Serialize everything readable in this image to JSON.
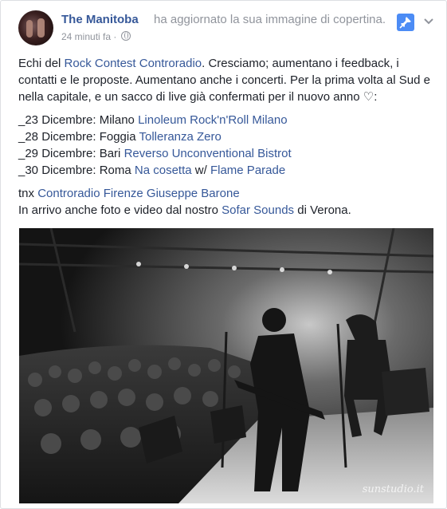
{
  "post": {
    "page_name": "The Manitoba",
    "action_text": "ha aggiornato la sua immagine di copertina.",
    "timestamp": "24 minuti fa",
    "meta_separator": "·",
    "pin_icon": "pin-icon",
    "chevron_icon": "chevron-down-icon",
    "privacy_icon": "globe-icon",
    "accent_color": "#4c8cf5",
    "link_color": "#365899"
  },
  "content": {
    "intro": {
      "t1": "Echi del ",
      "link1": "Rock Contest Controradio",
      "t2": ". Cresciamo; aumentano i feedback, i contatti e le proposte. Aumentano anche i concerti. Per la prima volta al Sud e nella capitale, e un sacco di live già confermati per il nuovo anno ♡:"
    },
    "dates": [
      {
        "prefix": "_23 Dicembre: Milano ",
        "link": "Linoleum Rock'n'Roll Milano"
      },
      {
        "prefix": "_28 Dicembre: Foggia ",
        "link": "Tolleranza Zero"
      },
      {
        "prefix": "_29 Dicembre: Bari ",
        "link": "Reverso Unconventional Bistrot"
      },
      {
        "prefix": "_30 Dicembre: Roma ",
        "link": "Na cosetta",
        "middle": " w/ ",
        "link2": "Flame Parade"
      }
    ],
    "thanks": {
      "prefix": "tnx ",
      "link1": "Controradio Firenze",
      "space": " ",
      "link2": "Giuseppe Barone"
    },
    "closing": {
      "t1": "In arrivo anche foto e video dal nostro ",
      "link": "Sofar Sounds",
      "t2": " di Verona."
    }
  },
  "photo": {
    "watermark": "sunstudio.it"
  }
}
